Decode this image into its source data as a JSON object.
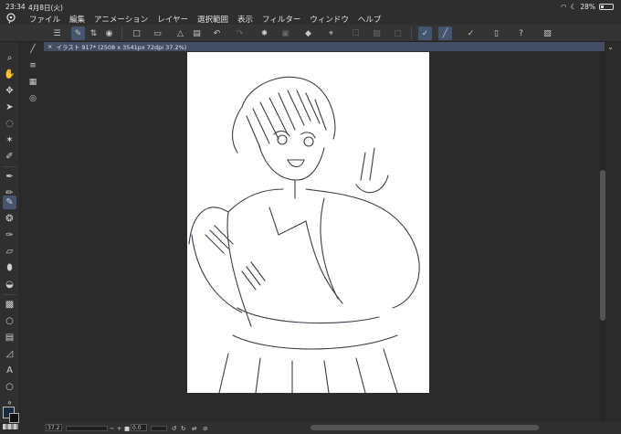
{
  "statusbar": {
    "time": "23:34",
    "date": "4月8日(火)",
    "battery": "28%"
  },
  "menu": [
    "ファイル",
    "編集",
    "アニメーション",
    "レイヤー",
    "選択範囲",
    "表示",
    "フィルター",
    "ウィンドウ",
    "ヘルプ"
  ],
  "tab": {
    "close": "×",
    "title": "イラスト 917* (2508 x 3541px 72dpi 37.2%)"
  },
  "bottom": {
    "zoom": "37.2",
    "rotation": "0.0"
  },
  "colors": {
    "main": "#1c2a40",
    "sub": "#111111",
    "accent": "#46546e"
  }
}
